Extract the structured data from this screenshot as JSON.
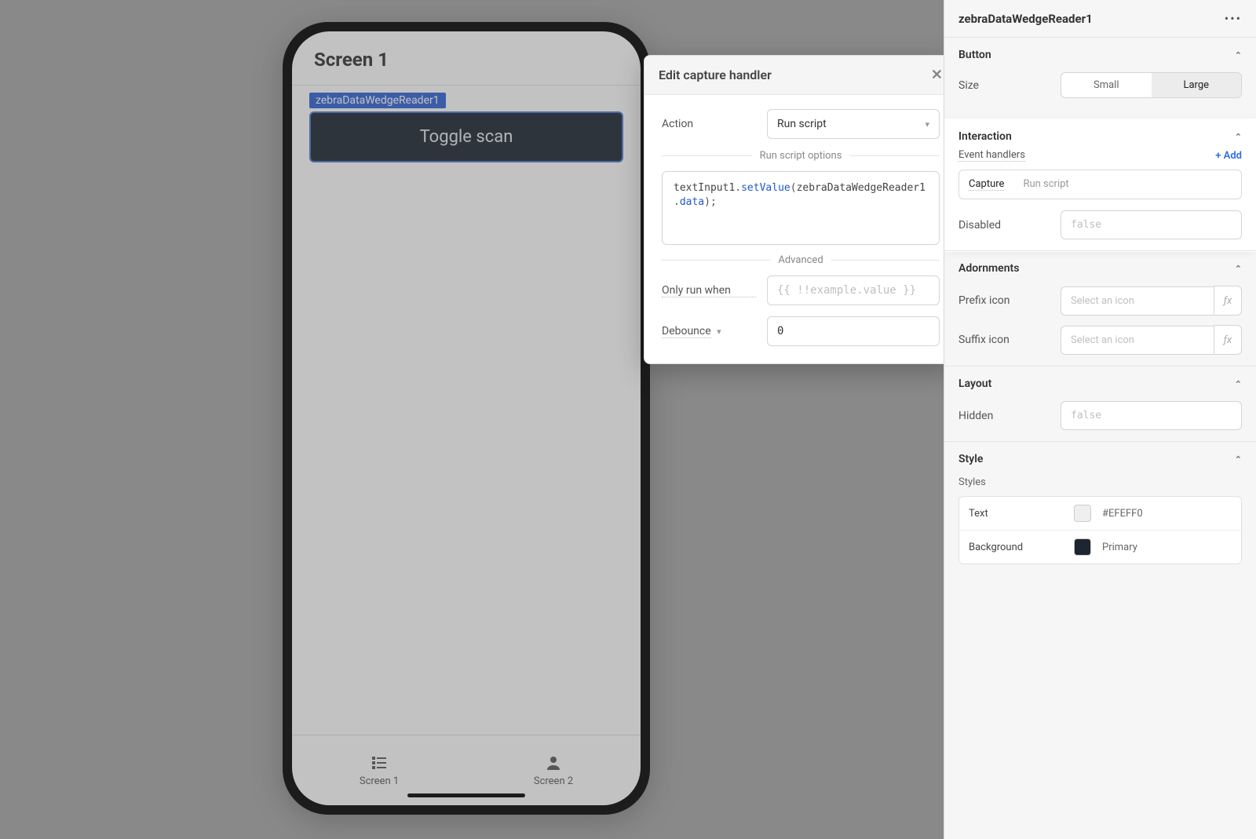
{
  "phone": {
    "screen_title": "Screen 1",
    "component_label": "zebraDataWedgeReader1",
    "button_label": "Toggle scan",
    "tabs": [
      {
        "label": "Screen 1"
      },
      {
        "label": "Screen 2"
      }
    ]
  },
  "popover": {
    "title": "Edit capture handler",
    "action_label": "Action",
    "action_value": "Run script",
    "options_heading": "Run script options",
    "script_tokens": {
      "obj": "textInput1",
      "fn": "setValue",
      "arg": "zebraDataWedgeReader1",
      "prop": "data"
    },
    "advanced_heading": "Advanced",
    "only_run_label": "Only run when",
    "only_run_placeholder": "{{ !!example.value }}",
    "debounce_label": "Debounce",
    "debounce_value": "0"
  },
  "panel": {
    "title": "zebraDataWedgeReader1",
    "sections": {
      "button": {
        "title": "Button",
        "size_label": "Size",
        "size_options": [
          "Small",
          "Large"
        ],
        "size_selected": "Large"
      },
      "interaction": {
        "title": "Interaction",
        "event_handlers_label": "Event handlers",
        "add_label": "+ Add",
        "handler_name": "Capture",
        "handler_action": "Run script",
        "disabled_label": "Disabled",
        "disabled_placeholder": "false"
      },
      "adornments": {
        "title": "Adornments",
        "prefix_label": "Prefix icon",
        "suffix_label": "Suffix icon",
        "icon_placeholder": "Select an icon"
      },
      "layout": {
        "title": "Layout",
        "hidden_label": "Hidden",
        "hidden_placeholder": "false"
      },
      "style": {
        "title": "Style",
        "styles_label": "Styles",
        "rows": [
          {
            "name": "Text",
            "swatch": "#EFEFF0",
            "value": "#EFEFF0"
          },
          {
            "name": "Background",
            "swatch": "#1d2530",
            "value": "Primary"
          }
        ]
      }
    }
  }
}
